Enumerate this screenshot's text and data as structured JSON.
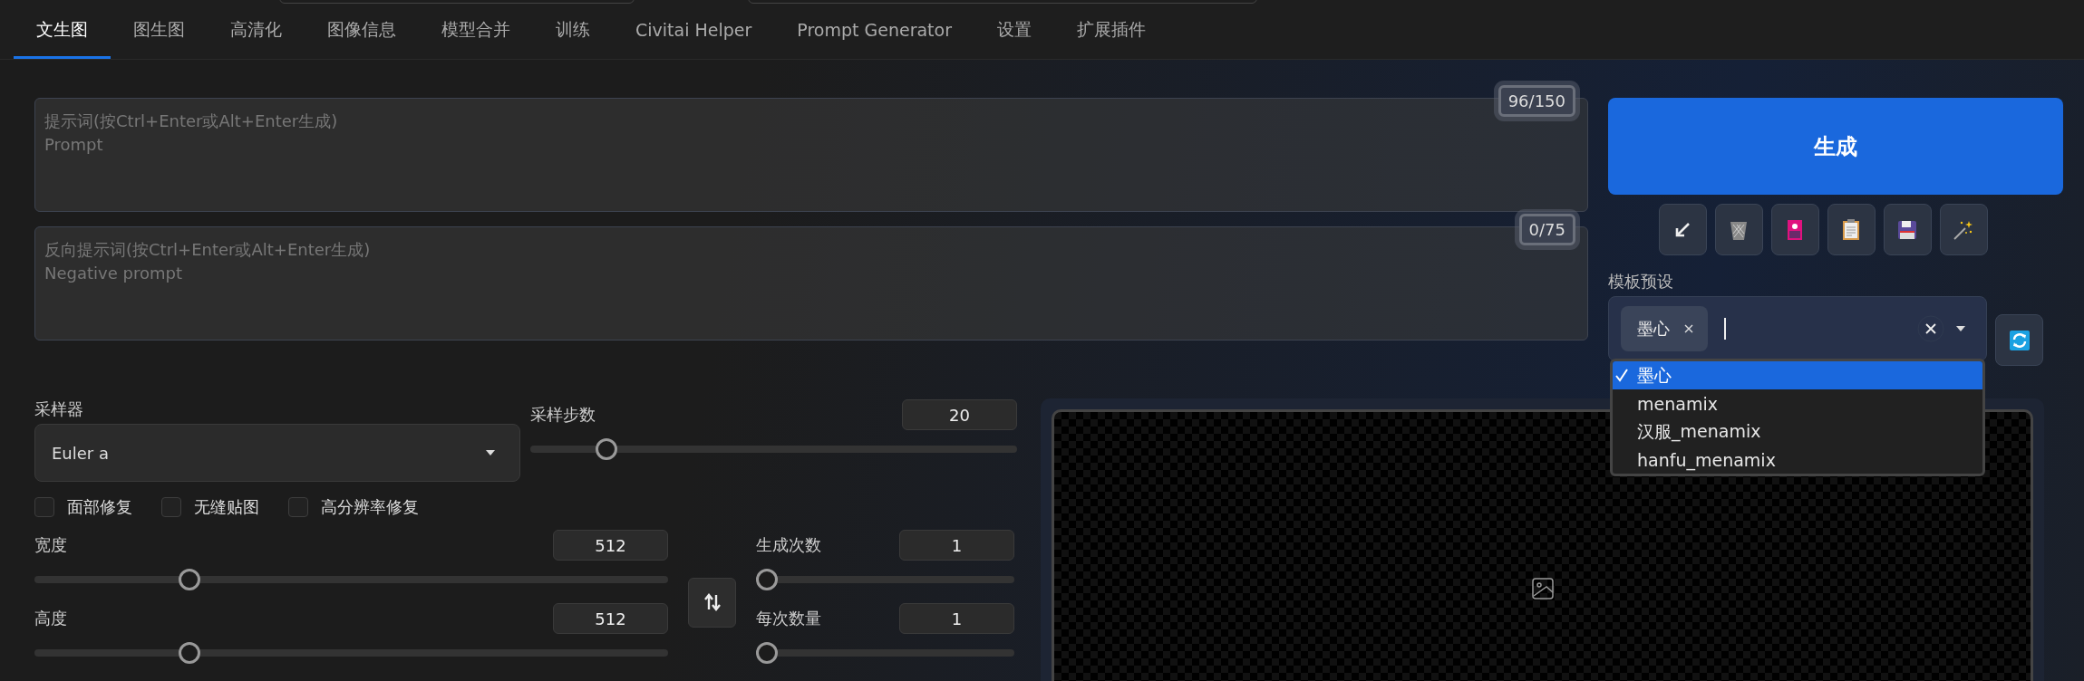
{
  "tabs": [
    {
      "label": "文生图",
      "selected": true
    },
    {
      "label": "图生图",
      "selected": false
    },
    {
      "label": "高清化",
      "selected": false
    },
    {
      "label": "图像信息",
      "selected": false
    },
    {
      "label": "模型合并",
      "selected": false
    },
    {
      "label": "训练",
      "selected": false
    },
    {
      "label": "Civitai Helper",
      "selected": false
    },
    {
      "label": "Prompt Generator",
      "selected": false
    },
    {
      "label": "设置",
      "selected": false
    },
    {
      "label": "扩展插件",
      "selected": false
    }
  ],
  "prompt": {
    "placeholder": "提示词(按Ctrl+Enter或Alt+Enter生成)\nPrompt",
    "counter": "96/150"
  },
  "negative_prompt": {
    "placeholder": "反向提示词(按Ctrl+Enter或Alt+Enter生成)\nNegative prompt",
    "counter": "0/75"
  },
  "generate_button": "生成",
  "styles": {
    "label": "模板预设",
    "tags": [
      "墨心"
    ],
    "options": [
      {
        "label": "墨心",
        "selected": true
      },
      {
        "label": "menamix",
        "selected": false
      },
      {
        "label": "汉服_menamix",
        "selected": false
      },
      {
        "label": "hanfu_menamix",
        "selected": false
      }
    ]
  },
  "sampler": {
    "label": "采样器",
    "value": "Euler a"
  },
  "steps": {
    "label": "采样步数",
    "value": "20",
    "level": 0.14
  },
  "checkboxes": [
    {
      "label": "面部修复",
      "checked": false
    },
    {
      "label": "无缝贴图",
      "checked": false
    },
    {
      "label": "高分辨率修复",
      "checked": false
    }
  ],
  "size_sliders": [
    {
      "label": "宽度",
      "value": "512",
      "level": 0.236
    },
    {
      "label": "高度",
      "value": "512",
      "level": 0.236
    }
  ],
  "batch_sliders": [
    {
      "label": "生成次数",
      "value": "1",
      "level": 0
    },
    {
      "label": "每次数量",
      "value": "1",
      "level": 0
    }
  ]
}
